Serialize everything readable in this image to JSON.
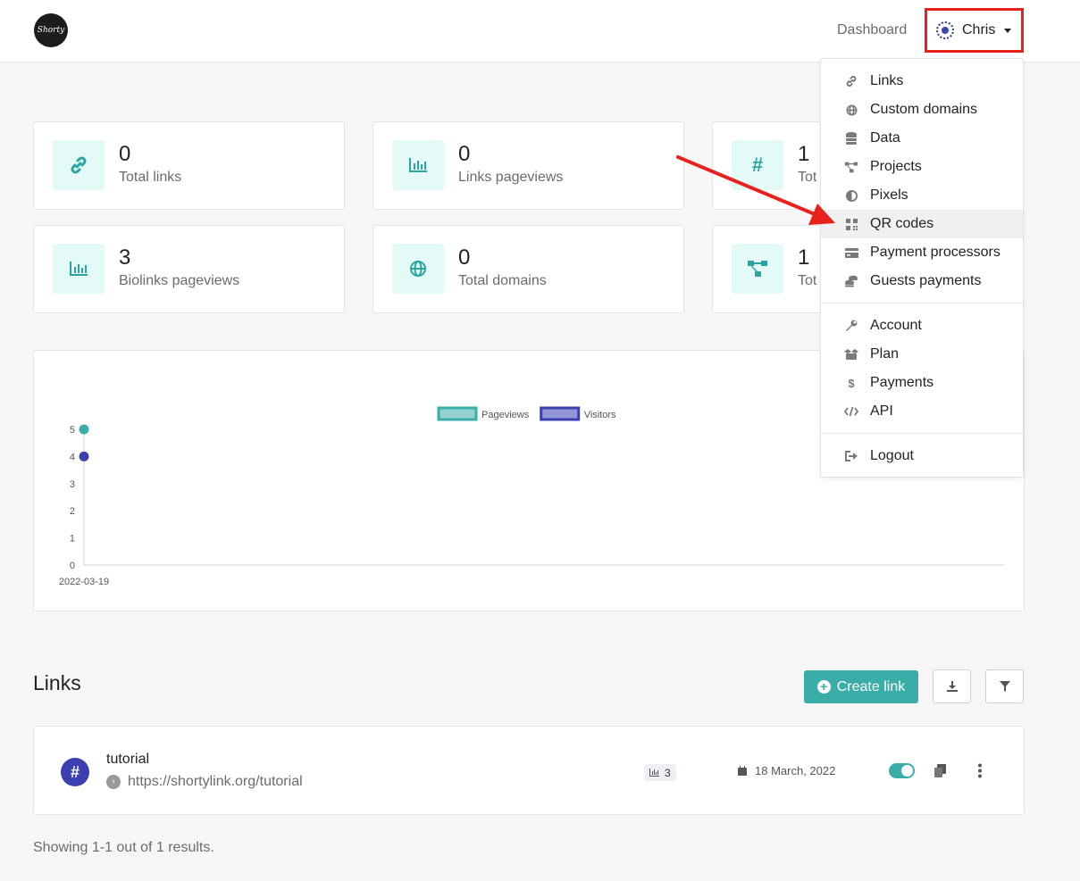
{
  "header": {
    "logo_text": "Shorty",
    "dashboard_label": "Dashboard",
    "user_name": "Chris"
  },
  "stats": [
    {
      "value": "0",
      "label": "Total links",
      "icon": "link-icon"
    },
    {
      "value": "0",
      "label": "Links pageviews",
      "icon": "bar-chart-icon"
    },
    {
      "value": "1",
      "label": "Tot",
      "icon": "hashtag-icon"
    },
    {
      "value": "3",
      "label": "Biolinks pageviews",
      "icon": "bar-chart-icon"
    },
    {
      "value": "0",
      "label": "Total domains",
      "icon": "globe-icon"
    },
    {
      "value": "1",
      "label": "Tot",
      "icon": "project-diagram-icon"
    }
  ],
  "dropdown": {
    "items": [
      {
        "label": "Links",
        "icon": "link-icon"
      },
      {
        "label": "Custom domains",
        "icon": "globe-icon"
      },
      {
        "label": "Data",
        "icon": "database-icon"
      },
      {
        "label": "Projects",
        "icon": "project-diagram-icon"
      },
      {
        "label": "Pixels",
        "icon": "adjust-icon"
      },
      {
        "label": "QR codes",
        "icon": "qrcode-icon"
      },
      {
        "label": "Payment processors",
        "icon": "credit-card-icon"
      },
      {
        "label": "Guests payments",
        "icon": "coins-icon"
      },
      {
        "label": "Account",
        "icon": "wrench-icon"
      },
      {
        "label": "Plan",
        "icon": "box-open-icon"
      },
      {
        "label": "Payments",
        "icon": "dollar-icon"
      },
      {
        "label": "API",
        "icon": "code-icon"
      },
      {
        "label": "Logout",
        "icon": "sign-out-icon"
      }
    ],
    "highlighted": "QR codes"
  },
  "chart_data": {
    "type": "line",
    "x": [
      "2022-03-19"
    ],
    "series": [
      {
        "name": "Pageviews",
        "values": [
          5
        ],
        "color": "#3aada9"
      },
      {
        "name": "Visitors",
        "values": [
          4
        ],
        "color": "#3b3fb0"
      }
    ],
    "yticks": [
      "0",
      "1",
      "2",
      "3",
      "4",
      "5"
    ],
    "ylim": [
      0,
      5
    ],
    "legend": "top-center",
    "grid": false
  },
  "links_section": {
    "title": "Links",
    "create_label": "Create link",
    "results_text": "Showing 1-1 out of 1 results.",
    "rows": [
      {
        "name": "tutorial",
        "url": "https://shortylink.org/tutorial",
        "pageviews": "3",
        "date": "18 March, 2022",
        "enabled": true
      }
    ]
  },
  "colors": {
    "accent": "#3aada9",
    "accent_light": "#e3faf6",
    "visitors": "#3b3fb0",
    "annotation": "#e8211d"
  }
}
